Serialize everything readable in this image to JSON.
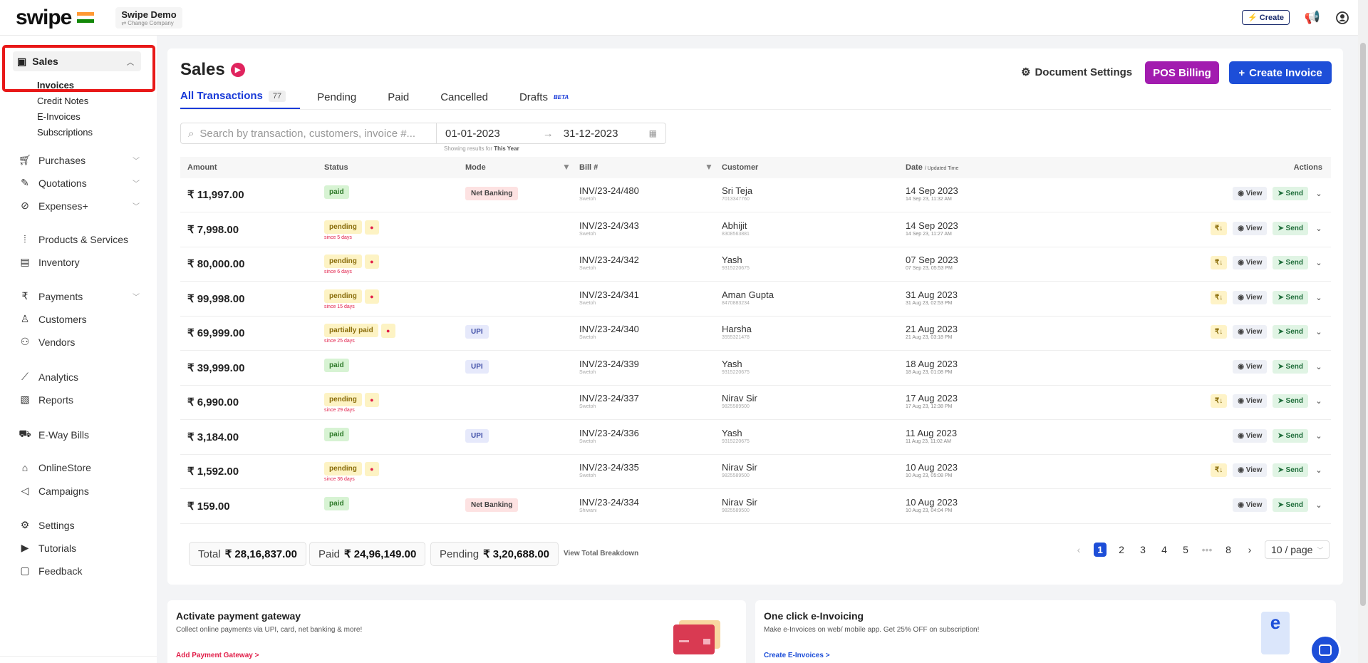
{
  "brand": {
    "logo": "swipe",
    "company": "Swipe Demo",
    "change": "⇄ Change Company",
    "flag_colors": [
      "#ff9933",
      "#ffffff",
      "#138808"
    ]
  },
  "top": {
    "create": "⚡ Create"
  },
  "sidebar": {
    "sales": "Sales",
    "sub": [
      "Invoices",
      "Credit Notes",
      "E-Invoices",
      "Subscriptions"
    ],
    "items": [
      {
        "label": "Purchases",
        "chev": true
      },
      {
        "label": "Quotations",
        "chev": true
      },
      {
        "label": "Expenses+",
        "chev": true
      },
      {
        "label": "Products & Services"
      },
      {
        "label": "Inventory"
      },
      {
        "label": "Payments",
        "chev": true
      },
      {
        "label": "Customers"
      },
      {
        "label": "Vendors"
      },
      {
        "label": "Analytics"
      },
      {
        "label": "Reports"
      },
      {
        "label": "E-Way Bills"
      },
      {
        "label": "OnlineStore"
      },
      {
        "label": "Campaigns"
      },
      {
        "label": "Settings"
      },
      {
        "label": "Tutorials"
      },
      {
        "label": "Feedback"
      }
    ]
  },
  "page": {
    "title": "Sales",
    "doc_settings": "Document Settings",
    "pos": "POS Billing",
    "create_invoice": "Create Invoice",
    "tabs": [
      {
        "label": "All Transactions",
        "count": "77"
      },
      {
        "label": "Pending"
      },
      {
        "label": "Paid"
      },
      {
        "label": "Cancelled"
      },
      {
        "label": "Drafts",
        "beta": "BETA"
      }
    ],
    "search_placeholder": "Search by transaction, customers, invoice #...",
    "date_from": "01-01-2023",
    "date_to": "31-12-2023",
    "showing": "Showing results for",
    "showing_period": "This Year"
  },
  "table": {
    "headers": {
      "amount": "Amount",
      "status": "Status",
      "mode": "Mode",
      "bill": "Bill #",
      "customer": "Customer",
      "date": "Date",
      "date_sub": "/ Updated Time",
      "actions": "Actions"
    },
    "rows": [
      {
        "amount": "₹ 11,997.00",
        "status": "paid",
        "since": "",
        "mode": "Net Banking",
        "bill": "INV/23-24/480",
        "bill_sub": "Swetoh",
        "customer": "Sri Teja",
        "phone": "7013347760",
        "date": "14 Sep 2023",
        "updated": "14 Sep 23, 11:32 AM",
        "rs": false
      },
      {
        "amount": "₹ 7,998.00",
        "status": "pending",
        "since": "since 5 days",
        "mode": "",
        "bill": "INV/23-24/343",
        "bill_sub": "Swetoh",
        "customer": "Abhijit",
        "phone": "8308563881",
        "date": "14 Sep 2023",
        "updated": "14 Sep 23, 11:27 AM",
        "rs": true
      },
      {
        "amount": "₹ 80,000.00",
        "status": "pending",
        "since": "since 6 days",
        "mode": "",
        "bill": "INV/23-24/342",
        "bill_sub": "Swetoh",
        "customer": "Yash",
        "phone": "9315220675",
        "date": "07 Sep 2023",
        "updated": "07 Sep 23, 05:53 PM",
        "rs": true
      },
      {
        "amount": "₹ 99,998.00",
        "status": "pending",
        "since": "since 15 days",
        "mode": "",
        "bill": "INV/23-24/341",
        "bill_sub": "Swetoh",
        "customer": "Aman Gupta",
        "phone": "8470883234",
        "date": "31 Aug 2023",
        "updated": "31 Aug 23, 02:53 PM",
        "rs": true
      },
      {
        "amount": "₹ 69,999.00",
        "status": "partially paid",
        "since": "since 25 days",
        "mode": "UPI",
        "bill": "INV/23-24/340",
        "bill_sub": "Swetoh",
        "customer": "Harsha",
        "phone": "3555321478",
        "date": "21 Aug 2023",
        "updated": "21 Aug 23, 03:18 PM",
        "rs": true
      },
      {
        "amount": "₹ 39,999.00",
        "status": "paid",
        "since": "",
        "mode": "UPI",
        "bill": "INV/23-24/339",
        "bill_sub": "Swetoh",
        "customer": "Yash",
        "phone": "9315220675",
        "date": "18 Aug 2023",
        "updated": "18 Aug 23, 01:08 PM",
        "rs": false
      },
      {
        "amount": "₹ 6,990.00",
        "status": "pending",
        "since": "since 29 days",
        "mode": "",
        "bill": "INV/23-24/337",
        "bill_sub": "Swetoh",
        "customer": "Nirav Sir",
        "phone": "9825589500",
        "date": "17 Aug 2023",
        "updated": "17 Aug 23, 12:38 PM",
        "rs": true
      },
      {
        "amount": "₹ 3,184.00",
        "status": "paid",
        "since": "",
        "mode": "UPI",
        "bill": "INV/23-24/336",
        "bill_sub": "Swetoh",
        "customer": "Yash",
        "phone": "9315220675",
        "date": "11 Aug 2023",
        "updated": "11 Aug 23, 11:02 AM",
        "rs": false
      },
      {
        "amount": "₹ 1,592.00",
        "status": "pending",
        "since": "since 36 days",
        "mode": "",
        "bill": "INV/23-24/335",
        "bill_sub": "Swetoh",
        "customer": "Nirav Sir",
        "phone": "9825589500",
        "date": "10 Aug 2023",
        "updated": "10 Aug 23, 05:08 PM",
        "rs": true
      },
      {
        "amount": "₹ 159.00",
        "status": "paid",
        "since": "",
        "mode": "Net Banking",
        "bill": "INV/23-24/334",
        "bill_sub": "Shiwani",
        "customer": "Nirav Sir",
        "phone": "9825589500",
        "date": "10 Aug 2023",
        "updated": "10 Aug 23, 04:04 PM",
        "rs": false
      }
    ],
    "view": "View",
    "send": "Send",
    "rs": "₹↓"
  },
  "totals": {
    "total_label": "Total",
    "total": "₹ 28,16,837.00",
    "paid_label": "Paid",
    "paid": "₹ 24,96,149.00",
    "pending_label": "Pending",
    "pending": "₹ 3,20,688.00",
    "breakdown": "View Total Breakdown"
  },
  "pager": {
    "pages": [
      "1",
      "2",
      "3",
      "4",
      "5",
      "•••",
      "8"
    ],
    "per_page": "10 / page"
  },
  "cards": [
    {
      "title": "Activate payment gateway",
      "desc": "Collect online payments via UPI, card, net banking & more!",
      "link": "Add Payment Gateway >",
      "link_color": "#e11d48"
    },
    {
      "title": "One click e-Invoicing",
      "desc": "Make e-Invoices on web/ mobile app. Get 25% OFF on subscription!",
      "link": "Create E-Invoices >",
      "link_color": "#1d4ed8"
    }
  ],
  "einvoice_glyph": "e"
}
